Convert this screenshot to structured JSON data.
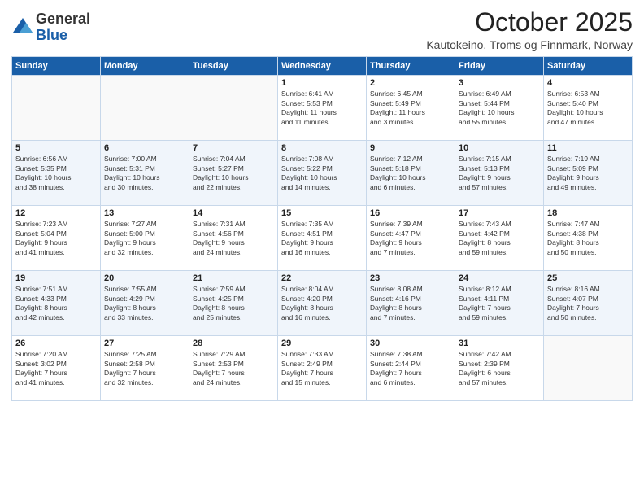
{
  "header": {
    "logo_general": "General",
    "logo_blue": "Blue",
    "month_title": "October 2025",
    "location": "Kautokeino, Troms og Finnmark, Norway"
  },
  "days_of_week": [
    "Sunday",
    "Monday",
    "Tuesday",
    "Wednesday",
    "Thursday",
    "Friday",
    "Saturday"
  ],
  "weeks": [
    [
      {
        "num": "",
        "info": ""
      },
      {
        "num": "",
        "info": ""
      },
      {
        "num": "",
        "info": ""
      },
      {
        "num": "1",
        "info": "Sunrise: 6:41 AM\nSunset: 5:53 PM\nDaylight: 11 hours\nand 11 minutes."
      },
      {
        "num": "2",
        "info": "Sunrise: 6:45 AM\nSunset: 5:49 PM\nDaylight: 11 hours\nand 3 minutes."
      },
      {
        "num": "3",
        "info": "Sunrise: 6:49 AM\nSunset: 5:44 PM\nDaylight: 10 hours\nand 55 minutes."
      },
      {
        "num": "4",
        "info": "Sunrise: 6:53 AM\nSunset: 5:40 PM\nDaylight: 10 hours\nand 47 minutes."
      }
    ],
    [
      {
        "num": "5",
        "info": "Sunrise: 6:56 AM\nSunset: 5:35 PM\nDaylight: 10 hours\nand 38 minutes."
      },
      {
        "num": "6",
        "info": "Sunrise: 7:00 AM\nSunset: 5:31 PM\nDaylight: 10 hours\nand 30 minutes."
      },
      {
        "num": "7",
        "info": "Sunrise: 7:04 AM\nSunset: 5:27 PM\nDaylight: 10 hours\nand 22 minutes."
      },
      {
        "num": "8",
        "info": "Sunrise: 7:08 AM\nSunset: 5:22 PM\nDaylight: 10 hours\nand 14 minutes."
      },
      {
        "num": "9",
        "info": "Sunrise: 7:12 AM\nSunset: 5:18 PM\nDaylight: 10 hours\nand 6 minutes."
      },
      {
        "num": "10",
        "info": "Sunrise: 7:15 AM\nSunset: 5:13 PM\nDaylight: 9 hours\nand 57 minutes."
      },
      {
        "num": "11",
        "info": "Sunrise: 7:19 AM\nSunset: 5:09 PM\nDaylight: 9 hours\nand 49 minutes."
      }
    ],
    [
      {
        "num": "12",
        "info": "Sunrise: 7:23 AM\nSunset: 5:04 PM\nDaylight: 9 hours\nand 41 minutes."
      },
      {
        "num": "13",
        "info": "Sunrise: 7:27 AM\nSunset: 5:00 PM\nDaylight: 9 hours\nand 32 minutes."
      },
      {
        "num": "14",
        "info": "Sunrise: 7:31 AM\nSunset: 4:56 PM\nDaylight: 9 hours\nand 24 minutes."
      },
      {
        "num": "15",
        "info": "Sunrise: 7:35 AM\nSunset: 4:51 PM\nDaylight: 9 hours\nand 16 minutes."
      },
      {
        "num": "16",
        "info": "Sunrise: 7:39 AM\nSunset: 4:47 PM\nDaylight: 9 hours\nand 7 minutes."
      },
      {
        "num": "17",
        "info": "Sunrise: 7:43 AM\nSunset: 4:42 PM\nDaylight: 8 hours\nand 59 minutes."
      },
      {
        "num": "18",
        "info": "Sunrise: 7:47 AM\nSunset: 4:38 PM\nDaylight: 8 hours\nand 50 minutes."
      }
    ],
    [
      {
        "num": "19",
        "info": "Sunrise: 7:51 AM\nSunset: 4:33 PM\nDaylight: 8 hours\nand 42 minutes."
      },
      {
        "num": "20",
        "info": "Sunrise: 7:55 AM\nSunset: 4:29 PM\nDaylight: 8 hours\nand 33 minutes."
      },
      {
        "num": "21",
        "info": "Sunrise: 7:59 AM\nSunset: 4:25 PM\nDaylight: 8 hours\nand 25 minutes."
      },
      {
        "num": "22",
        "info": "Sunrise: 8:04 AM\nSunset: 4:20 PM\nDaylight: 8 hours\nand 16 minutes."
      },
      {
        "num": "23",
        "info": "Sunrise: 8:08 AM\nSunset: 4:16 PM\nDaylight: 8 hours\nand 7 minutes."
      },
      {
        "num": "24",
        "info": "Sunrise: 8:12 AM\nSunset: 4:11 PM\nDaylight: 7 hours\nand 59 minutes."
      },
      {
        "num": "25",
        "info": "Sunrise: 8:16 AM\nSunset: 4:07 PM\nDaylight: 7 hours\nand 50 minutes."
      }
    ],
    [
      {
        "num": "26",
        "info": "Sunrise: 7:20 AM\nSunset: 3:02 PM\nDaylight: 7 hours\nand 41 minutes."
      },
      {
        "num": "27",
        "info": "Sunrise: 7:25 AM\nSunset: 2:58 PM\nDaylight: 7 hours\nand 32 minutes."
      },
      {
        "num": "28",
        "info": "Sunrise: 7:29 AM\nSunset: 2:53 PM\nDaylight: 7 hours\nand 24 minutes."
      },
      {
        "num": "29",
        "info": "Sunrise: 7:33 AM\nSunset: 2:49 PM\nDaylight: 7 hours\nand 15 minutes."
      },
      {
        "num": "30",
        "info": "Sunrise: 7:38 AM\nSunset: 2:44 PM\nDaylight: 7 hours\nand 6 minutes."
      },
      {
        "num": "31",
        "info": "Sunrise: 7:42 AM\nSunset: 2:39 PM\nDaylight: 6 hours\nand 57 minutes."
      },
      {
        "num": "",
        "info": ""
      }
    ]
  ]
}
